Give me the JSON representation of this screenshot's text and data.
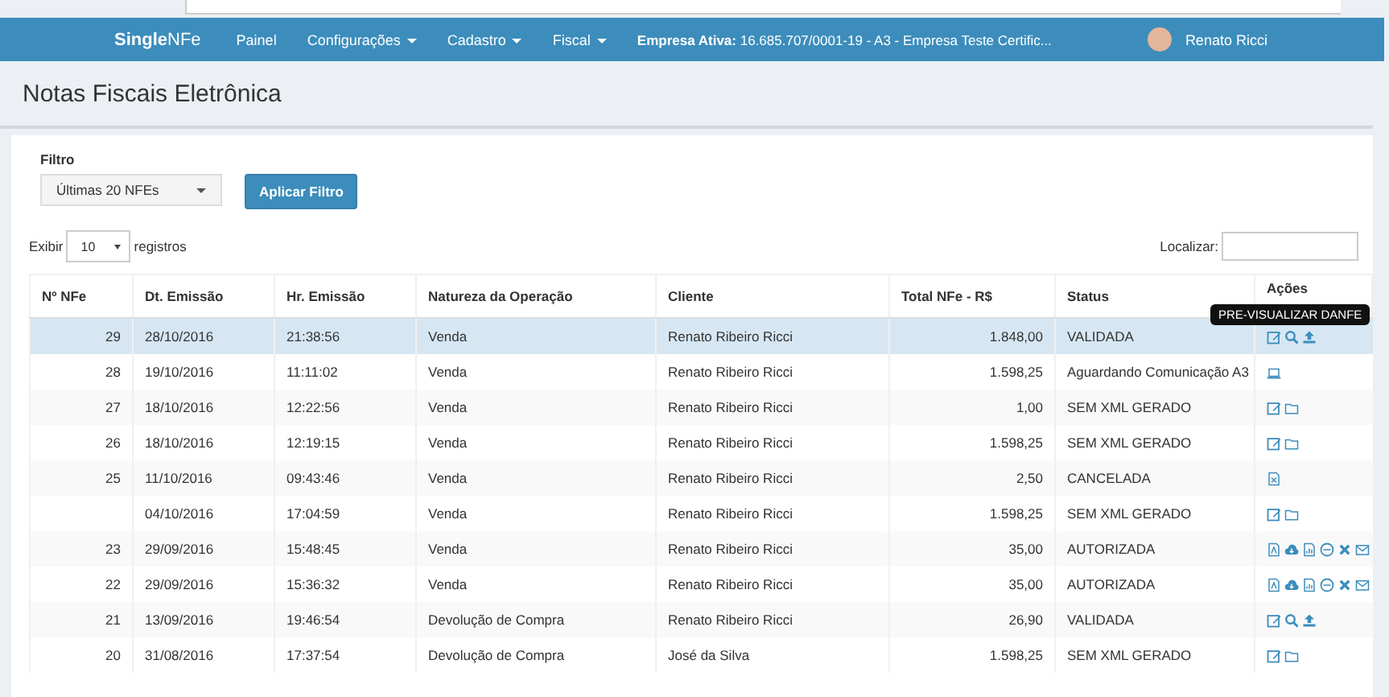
{
  "navbar": {
    "brand_bold": "Single",
    "brand_rest": "NFe",
    "items": [
      {
        "label": "Painel",
        "dropdown": false
      },
      {
        "label": "Configurações",
        "dropdown": true
      },
      {
        "label": "Cadastro",
        "dropdown": true
      },
      {
        "label": "Fiscal",
        "dropdown": true
      }
    ],
    "company_label": "Empresa Ativa:",
    "company_value": "16.685.707/0001-19 - A3 - Empresa Teste Certific...",
    "user": "Renato Ricci"
  },
  "page_title": "Notas Fiscais Eletrônica",
  "filter": {
    "label": "Filtro",
    "value": "Últimas 20 NFEs",
    "button": "Aplicar Filtro"
  },
  "length": {
    "before": "Exibir",
    "value": "10",
    "after": "registros"
  },
  "search": {
    "label": "Localizar:"
  },
  "table": {
    "columns": [
      "Nº NFe",
      "Dt. Emissão",
      "Hr. Emissão",
      "Natureza da Operação",
      "Cliente",
      "Total NFe - R$",
      "Status",
      "Ações"
    ],
    "rows": [
      {
        "number": "29",
        "date": "28/10/2016",
        "time": "21:38:56",
        "operation": "Venda",
        "client": "Renato Ribeiro Ricci",
        "total": "1.848,00",
        "status": "VALIDADA",
        "actions": [
          {
            "kind": "edit"
          },
          {
            "kind": "search"
          },
          {
            "kind": "upload"
          }
        ],
        "selected": true
      },
      {
        "number": "28",
        "date": "19/10/2016",
        "time": "11:11:02",
        "operation": "Venda",
        "client": "Renato Ribeiro Ricci",
        "total": "1.598,25",
        "status": "Aguardando Comunicação A3",
        "actions": [
          {
            "kind": "laptop"
          }
        ],
        "selected": false
      },
      {
        "number": "27",
        "date": "18/10/2016",
        "time": "12:22:56",
        "operation": "Venda",
        "client": "Renato Ribeiro Ricci",
        "total": "1,00",
        "status": "SEM XML GERADO",
        "actions": [
          {
            "kind": "edit"
          },
          {
            "kind": "folder"
          }
        ],
        "selected": false
      },
      {
        "number": "26",
        "date": "18/10/2016",
        "time": "12:19:15",
        "operation": "Venda",
        "client": "Renato Ribeiro Ricci",
        "total": "1.598,25",
        "status": "SEM XML GERADO",
        "actions": [
          {
            "kind": "edit"
          },
          {
            "kind": "folder"
          }
        ],
        "selected": false
      },
      {
        "number": "25",
        "date": "11/10/2016",
        "time": "09:43:46",
        "operation": "Venda",
        "client": "Renato Ribeiro Ricci",
        "total": "2,50",
        "status": "CANCELADA",
        "actions": [
          {
            "kind": "file-x"
          }
        ],
        "selected": false
      },
      {
        "date": "04/10/2016",
        "time": "17:04:59",
        "operation": "Venda",
        "client": "Renato Ribeiro Ricci",
        "total": "1.598,25",
        "status": "SEM XML GERADO",
        "actions": [
          {
            "kind": "edit"
          },
          {
            "kind": "folder"
          }
        ],
        "selected": false
      },
      {
        "number": "23",
        "date": "29/09/2016",
        "time": "15:48:45",
        "operation": "Venda",
        "client": "Renato Ribeiro Ricci",
        "total": "35,00",
        "status": "AUTORIZADA",
        "actions": [
          {
            "kind": "pdf"
          },
          {
            "kind": "cloud"
          },
          {
            "kind": "chart"
          },
          {
            "kind": "circle"
          },
          {
            "kind": "close"
          },
          {
            "kind": "mail"
          }
        ],
        "selected": false
      },
      {
        "number": "22",
        "date": "29/09/2016",
        "time": "15:36:32",
        "operation": "Venda",
        "client": "Renato Ribeiro Ricci",
        "total": "35,00",
        "status": "AUTORIZADA",
        "actions": [
          {
            "kind": "pdf"
          },
          {
            "kind": "cloud"
          },
          {
            "kind": "chart"
          },
          {
            "kind": "circle"
          },
          {
            "kind": "close"
          },
          {
            "kind": "mail"
          }
        ],
        "selected": false
      },
      {
        "number": "21",
        "date": "13/09/2016",
        "time": "19:46:54",
        "operation": "Devolução de Compra",
        "client": "Renato Ribeiro Ricci",
        "total": "26,90",
        "status": "VALIDADA",
        "actions": [
          {
            "kind": "edit"
          },
          {
            "kind": "search"
          },
          {
            "kind": "upload"
          }
        ],
        "selected": false
      },
      {
        "number": "20",
        "date": "31/08/2016",
        "time": "17:37:54",
        "operation": "Devolução de Compra",
        "client": "José da Silva",
        "total": "1.598,25",
        "status": "SEM XML GERADO",
        "actions": [
          {
            "kind": "edit"
          },
          {
            "kind": "folder"
          }
        ],
        "selected": false
      }
    ]
  },
  "tooltip": "PRE-VISUALIZAR DANFE"
}
